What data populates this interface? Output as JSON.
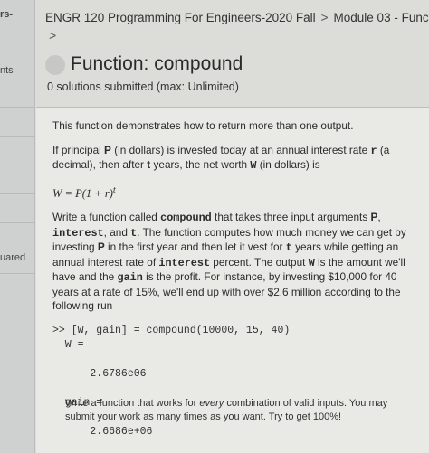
{
  "sidebar": {
    "items": [
      {
        "label": "rs-"
      },
      {
        "label": "nts"
      },
      {
        "label": "uared"
      }
    ]
  },
  "breadcrumb": {
    "course": "ENGR 120 Programming For Engineers-2020 Fall",
    "separator": ">",
    "module": "Module 03 - Functions",
    "continuation": ">"
  },
  "problem": {
    "title": "Function: compound",
    "submissions": "0 solutions submitted (max: Unlimited)"
  },
  "description": {
    "intro": "This function demonstrates how to return more than one output.",
    "p2_a": "If principal ",
    "p2_P": "P",
    "p2_b": " (in dollars) is invested today at an annual interest rate ",
    "p2_r": "r",
    "p2_c": " (a decimal), then after ",
    "p2_t": "t",
    "p2_d": " years, the net worth ",
    "p2_W": "W",
    "p2_e": " (in dollars) is",
    "formula": "W = P(1 + r)",
    "formula_exp": "t",
    "p3_a": "Write a function called ",
    "p3_fn": "compound",
    "p3_b": " that takes three input arguments ",
    "p3_P": "P",
    "p3_c": ", ",
    "p3_interest": "interest",
    "p3_d": ", and ",
    "p3_t": "t",
    "p3_e": ". The function computes how much money we can get by investing ",
    "p3_P2": "P",
    "p3_f": " in the first year and then let it vest for ",
    "p3_t2": "t",
    "p3_g": " years while getting an annual interest rate of ",
    "p3_interest2": "interest",
    "p3_h": " percent. The output ",
    "p3_W": "W",
    "p3_i": " is the amount we'll have and the ",
    "p3_gain": "gain",
    "p3_j": " is the profit. For instance, by investing $10,000 for 40 years at a rate of 15%, we'll end up with over $2.6 million according to the following run",
    "code": ">> [W, gain] = compound(10000, 15, 40)\n  W =\n\n      2.6786e06\n\n  gain =\n\n      2.6686e+06",
    "footer_a": "Write a function that works for ",
    "footer_em": "every",
    "footer_b": " combination of valid inputs.  You may submit your work as many times as you want.  Try to get 100%!"
  }
}
